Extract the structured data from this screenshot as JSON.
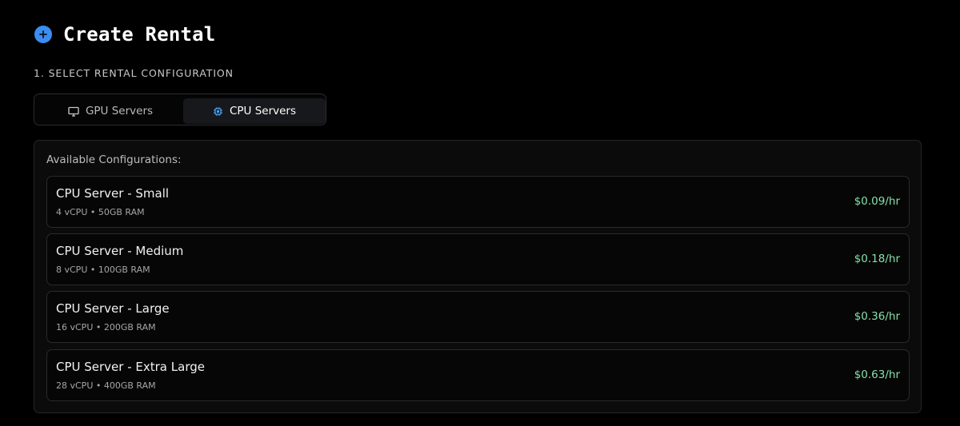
{
  "header": {
    "title": "Create Rental",
    "icon": "plus-circle-icon",
    "icon_color": "#3b8df1"
  },
  "step": {
    "label": "1. SELECT RENTAL CONFIGURATION"
  },
  "tabs": [
    {
      "label": "GPU Servers",
      "icon": "monitor-icon",
      "active": false
    },
    {
      "label": "CPU Servers",
      "icon": "cpu-chip-icon",
      "active": true
    }
  ],
  "panel": {
    "heading": "Available Configurations:",
    "configs": [
      {
        "name": "CPU Server - Small",
        "specs": "4 vCPU • 50GB RAM",
        "price": "$0.09/hr"
      },
      {
        "name": "CPU Server - Medium",
        "specs": "8 vCPU • 100GB RAM",
        "price": "$0.18/hr"
      },
      {
        "name": "CPU Server - Large",
        "specs": "16 vCPU • 200GB RAM",
        "price": "$0.36/hr"
      },
      {
        "name": "CPU Server - Extra Large",
        "specs": "28 vCPU • 400GB RAM",
        "price": "$0.63/hr"
      }
    ]
  },
  "colors": {
    "background": "#000000",
    "accent": "#3b8df1",
    "price": "#86e0a8"
  }
}
